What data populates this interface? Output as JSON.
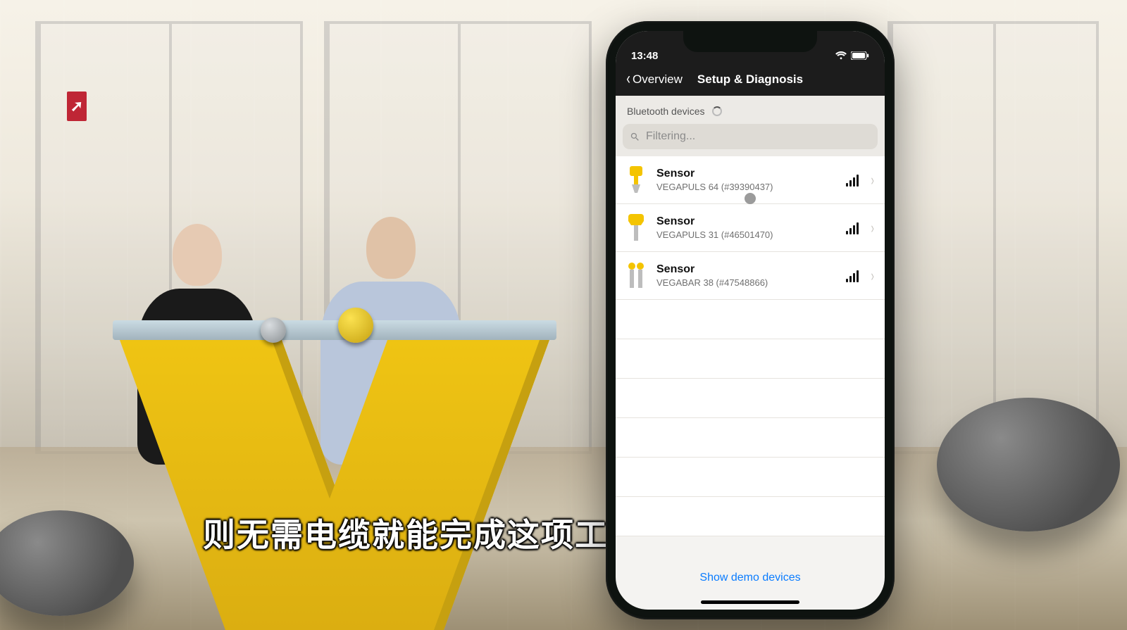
{
  "subtitle": "则无需电缆就能完成这项工作",
  "phone": {
    "status_time": "13:48",
    "nav": {
      "back_label": "Overview",
      "title": "Setup & Diagnosis"
    },
    "section_header": "Bluetooth devices",
    "search": {
      "placeholder": "Filtering..."
    },
    "devices": [
      {
        "title": "Sensor",
        "sub": "VEGAPULS 64 (#39390437)"
      },
      {
        "title": "Sensor",
        "sub": "VEGAPULS 31 (#46501470)"
      },
      {
        "title": "Sensor",
        "sub": "VEGABAR 38 (#47548866)"
      }
    ],
    "footer_link": "Show demo devices"
  },
  "icons": {
    "exit_glyph": "➚"
  }
}
